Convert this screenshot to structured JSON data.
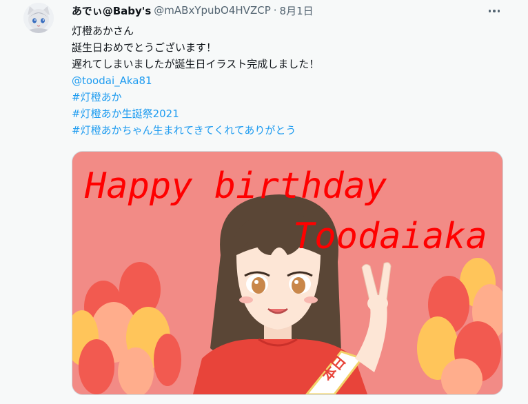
{
  "tweet": {
    "display_name": "あでぃ@Baby's",
    "handle": "@mABxYpubO4HVZCP",
    "separator": "·",
    "date": "8月1日",
    "more_icon": "more-horizontal-icon",
    "lines": [
      {
        "text": "灯橙あかさん",
        "link": false
      },
      {
        "text": "誕生日おめでとうございます！",
        "link": false
      },
      {
        "text": "遅れてしまいましたが誕生日イラスト完成しました！",
        "link": false
      },
      {
        "text": "@toodai_Aka81",
        "link": true
      },
      {
        "text": "#灯橙あか",
        "link": true
      },
      {
        "text": "#灯橙あか生誕祭2021",
        "link": true
      },
      {
        "text": "#灯橙あかちゃん生まれてきてくれてありがとう",
        "link": true
      }
    ],
    "image": {
      "title_line1": "Happy birthday",
      "title_line2": "Toodaiaka",
      "sash_text": "本日",
      "colors": {
        "background": "#f28b86",
        "title": "#ff0000",
        "hair": "#5a4636",
        "skin": "#fde6d6",
        "shirt": "#e8443a",
        "sash": "#ffffff",
        "balloon_red": "#f25a50",
        "balloon_yellow": "#ffc55a",
        "balloon_peach": "#ffad8c"
      }
    }
  },
  "colors": {
    "link": "#1d9bf0",
    "text": "#0f1419",
    "muted": "#536471",
    "background": "#f7f9f9"
  }
}
